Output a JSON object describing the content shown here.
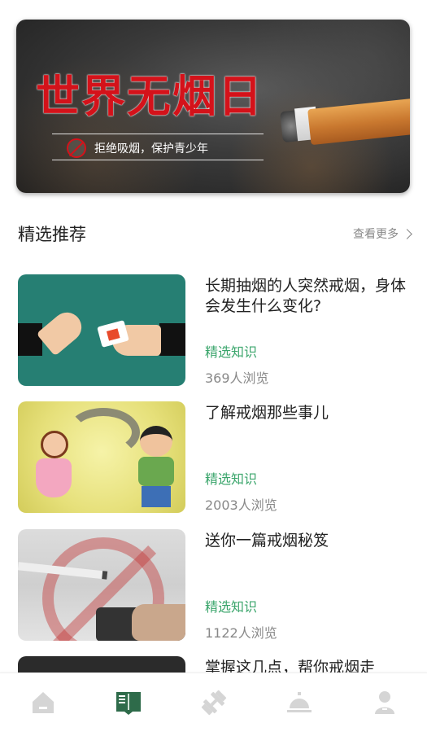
{
  "banner": {
    "title": "世界无烟日",
    "subtitle": "拒绝吸烟，保护青少年"
  },
  "section": {
    "title": "精选推荐",
    "more_label": "查看更多"
  },
  "articles": [
    {
      "title": "长期抽烟的人突然戒烟，身体会发生什么变化?",
      "tag": "精选知识",
      "views": "369人浏览"
    },
    {
      "title": "了解戒烟那些事儿",
      "tag": "精选知识",
      "views": "2003人浏览"
    },
    {
      "title": "送你一篇戒烟秘笈",
      "tag": "精选知识",
      "views": "1122人浏览"
    },
    {
      "title": "掌握这几点，帮你戒烟走"
    }
  ],
  "tabbar": {
    "tabs": [
      {
        "icon": "home-icon",
        "active": false
      },
      {
        "icon": "book-icon",
        "active": true
      },
      {
        "icon": "dumbbell-icon",
        "active": false
      },
      {
        "icon": "service-bell-icon",
        "active": false
      },
      {
        "icon": "person-icon",
        "active": false
      }
    ],
    "active_color": "#2e6b4a",
    "inactive_color": "#d5d5d5"
  },
  "colors": {
    "accent_green": "#3aa56b",
    "banner_red": "#d4121a"
  }
}
